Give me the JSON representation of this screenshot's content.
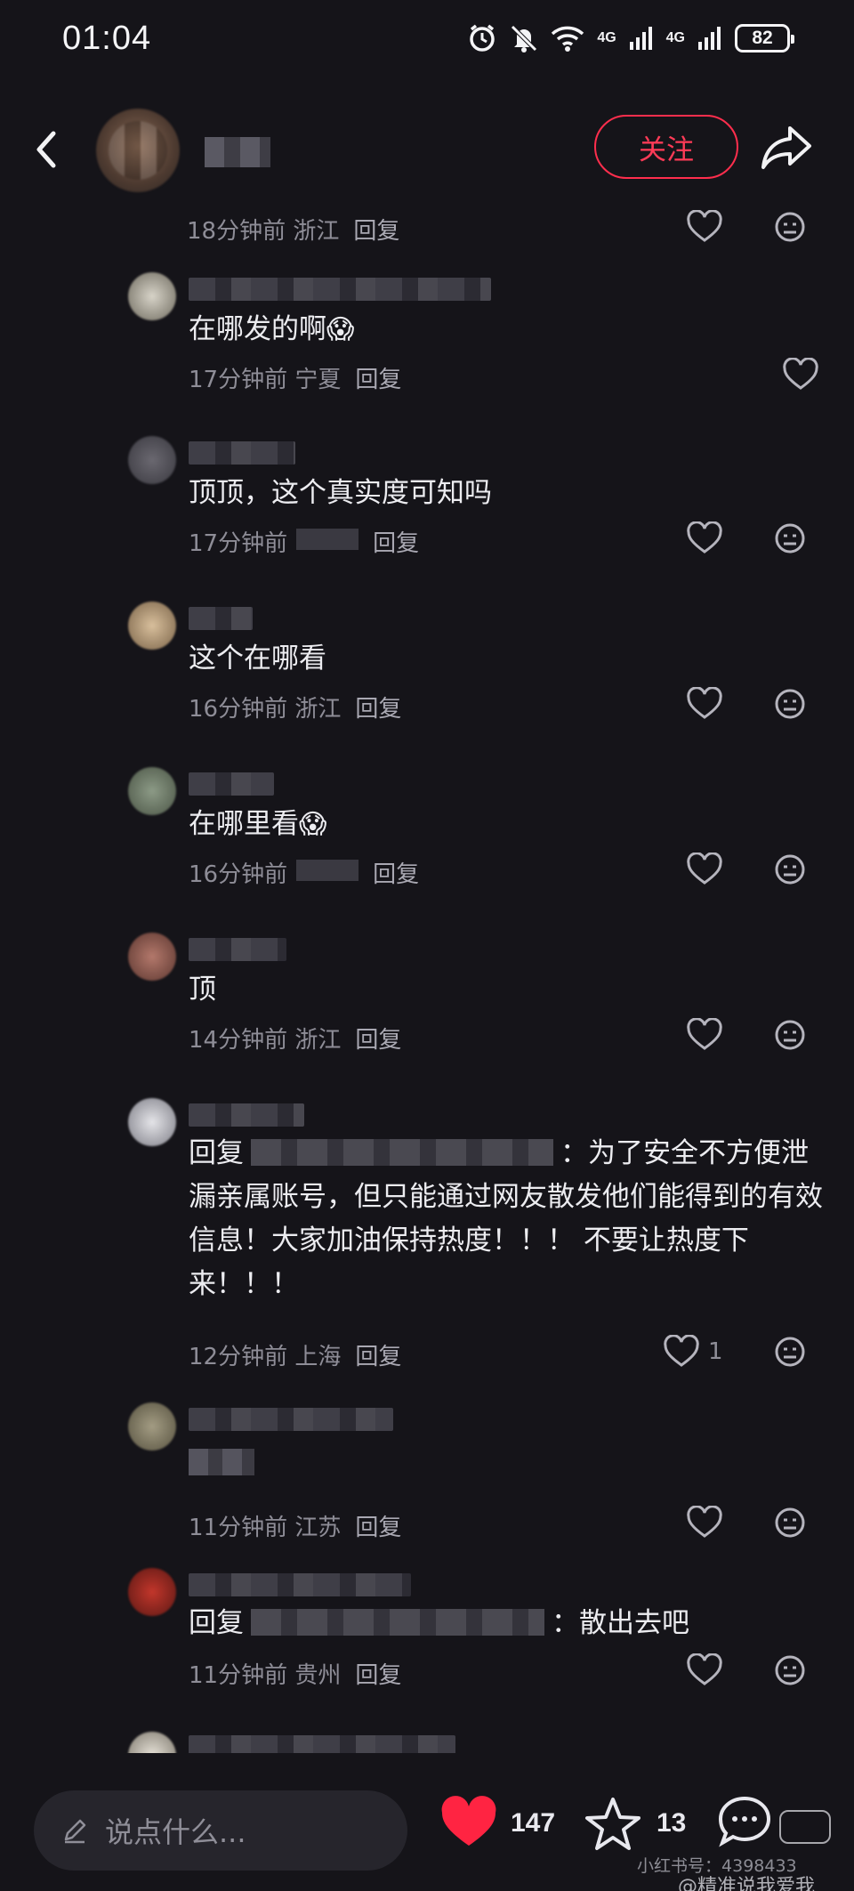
{
  "status_bar": {
    "time": "01:04",
    "net1": "4G",
    "net2": "4G",
    "battery": "82"
  },
  "header": {
    "follow_label": "关注"
  },
  "comments": [
    {
      "text": "",
      "location": "18分钟前 浙江",
      "reply": "回复"
    },
    {
      "text": "在哪发的啊",
      "emoji": "😱",
      "location": "17分钟前 宁夏",
      "reply": "回复"
    },
    {
      "text": "顶顶，这个真实度可知吗",
      "location": "17分钟前",
      "reply": "回复"
    },
    {
      "text": "这个在哪看",
      "location": "16分钟前 浙江",
      "reply": "回复"
    },
    {
      "text": "在哪里看",
      "emoji": "😱",
      "location": "16分钟前",
      "reply": "回复"
    },
    {
      "text": "顶",
      "location": "14分钟前 浙江",
      "reply": "回复"
    },
    {
      "prefix": "回复",
      "colon": "：",
      "text": "为了安全不方便泄漏亲属账号，但只能通过网友散发他们能得到的有效信息！大家加油保持热度！！！ 不要让热度下来！！！",
      "location": "12分钟前 上海",
      "reply": "回复",
      "likes": "1"
    },
    {
      "text": "",
      "location": "11分钟前 江苏",
      "reply": "回复"
    },
    {
      "prefix": "回复",
      "colon": "：",
      "text": "散出去吧",
      "location": "11分钟前 贵州",
      "reply": "回复"
    }
  ],
  "bottom_bar": {
    "placeholder": "说点什么...",
    "likes": "147",
    "stars": "13"
  },
  "watermarks": {
    "xhs": "小红书号：",
    "xhs_id": "4398433",
    "weibo": "@精准说我爱我"
  }
}
